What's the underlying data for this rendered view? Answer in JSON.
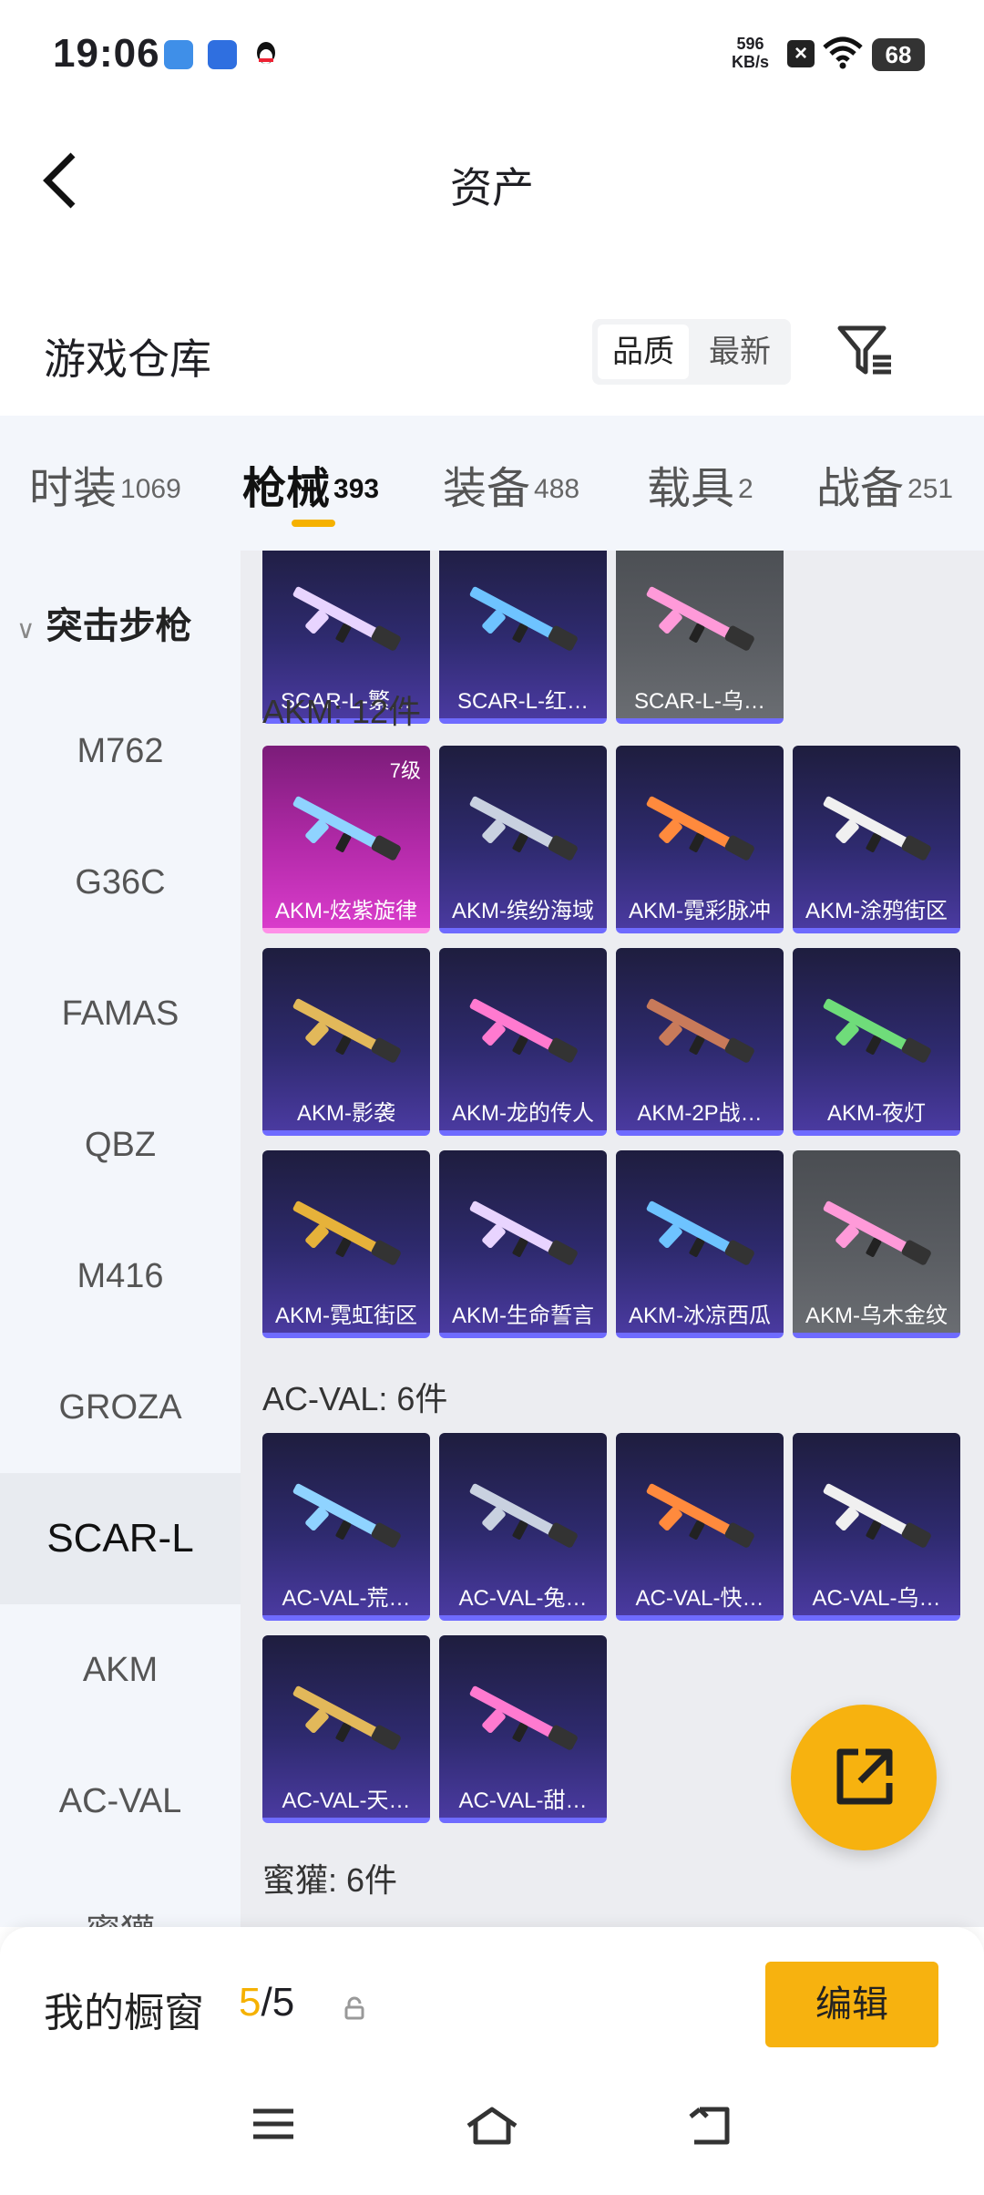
{
  "status": {
    "time": "19:06",
    "speed_value": "596",
    "speed_unit": "KB/s",
    "battery": "68"
  },
  "header": {
    "title": "资产"
  },
  "section": {
    "title": "游戏仓库",
    "sort_options": [
      "品质",
      "最新"
    ],
    "sort_active": "品质"
  },
  "tabs": [
    {
      "name": "时装",
      "count": "1069"
    },
    {
      "name": "枪械",
      "count": "393"
    },
    {
      "name": "装备",
      "count": "488"
    },
    {
      "name": "载具",
      "count": "2"
    },
    {
      "name": "战备",
      "count": "251"
    }
  ],
  "active_tab": "枪械",
  "sidebar": {
    "group": "突击步枪",
    "items": [
      "M762",
      "G36C",
      "FAMAS",
      "QBZ",
      "M416",
      "GROZA",
      "SCAR-L",
      "AKM",
      "AC-VAL",
      "蜜獾"
    ],
    "active": "SCAR-L"
  },
  "groups": {
    "scar_cards": [
      "SCAR-L-繁…",
      "SCAR-L-红…",
      "SCAR-L-乌…"
    ],
    "akm_title": "AKM: 12件",
    "akm_level": "7级",
    "akm_cards": [
      "AKM-炫紫旋律",
      "AKM-缤纷海域",
      "AKM-霓彩脉冲",
      "AKM-涂鸦街区",
      "AKM-影袭",
      "AKM-龙的传人",
      "AKM-2P战…",
      "AKM-夜灯",
      "AKM-霓虹街区",
      "AKM-生命誓言",
      "AKM-冰凉西瓜",
      "AKM-乌木金纹"
    ],
    "acval_title": "AC-VAL: 6件",
    "acval_cards": [
      "AC-VAL-荒…",
      "AC-VAL-兔…",
      "AC-VAL-快…",
      "AC-VAL-乌…",
      "AC-VAL-天…",
      "AC-VAL-甜…"
    ],
    "honey_title": "蜜獾: 6件"
  },
  "bottom": {
    "window_label": "我的橱窗",
    "count_current": "5",
    "count_sep_total": "/5",
    "edit_label": "编辑"
  },
  "colors": {
    "accent": "#f7b20f",
    "card_rarity": "#6f6bff"
  }
}
